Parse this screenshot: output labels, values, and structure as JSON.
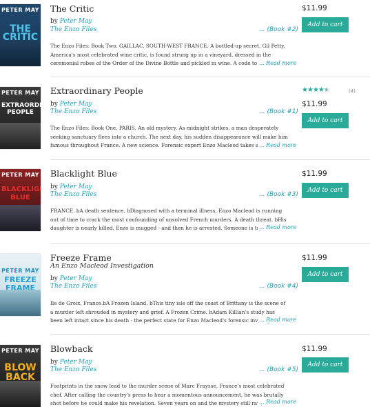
{
  "books": [
    {
      "title": "The Critic",
      "by": "by",
      "author": "Peter May",
      "series": "The Enzo Files",
      "book_num": "... (Book #2)",
      "description": "The Enzo Files: Book Two. GAILLAC, SOUTH-WEST FRANCE. A bottled-up secret. Gil Petty, America's most celebrated wine critic, is found strung up in a vineyard, dressed in the ceremonial robes of the Order of the Divine Bottle and pickled in wine. A code to c...",
      "read_more": "... Read more",
      "price": "$11.99",
      "cart_label": "Add to cart",
      "cover_author": "PETER MAY",
      "cover_title": "THE CRITIC",
      "cover_color": "#1b3f63"
    },
    {
      "title": "Extraordinary People",
      "by": "by",
      "author": "Peter May",
      "series": "The Enzo Files",
      "book_num": "... (Book #1)",
      "description": "The Enzo Files: Book One. PARIS. An old mystery. As midnight strikes, a man desperately seeking sanctuary flees into a church. The next day, his sudden disappearance will make him famous throughout France. A new science. Forensic expert Enzo Macleod takes a ...",
      "read_more": "... Read more",
      "price": "$11.99",
      "cart_label": "Add to cart",
      "rating": 4.5,
      "rating_stars": "★★★★★",
      "rating_count": "(4)",
      "cover_author": "PETER MAY",
      "cover_title": "EXTRAORDINARY PEOPLE",
      "cover_color": "#2d2d2d"
    },
    {
      "title": "Blacklight Blue",
      "by": "by",
      "author": "Peter May",
      "series": "The Enzo Files",
      "book_num": "... (Book #3)",
      "description": "FRANCE. bA death sentence. bDiagnosed with a terminal illness, Enzo Macleod is running out of time to crack the most confounding of unsolved French murders. A death threat. bHis daughter is nearly killed, Enzo is mugged - and then he is arrested. Someone is tryi...",
      "read_more": "... Read more",
      "price": "$11.99",
      "cart_label": "Add to cart",
      "cover_author": "PETER MAY",
      "cover_title": "BLACKLIGHT BLUE",
      "cover_color": "#7a1c1c"
    },
    {
      "title": "Freeze Frame",
      "subtitle": "An Enzo Macleod Investigation",
      "by": "by",
      "author": "Peter May",
      "series": "The Enzo Files",
      "book_num": "... (Book #4)",
      "description": "Ile de Groix, France.bA Frozen Island. bThis tiny isle off the coast of Brittany is the scene of a murder left shrouded in mystery and grief. A Frozen Crime. bAdam Killian's study has been left intact since his death - the perfect state for Enzo Macleod's forensic investigation. ...",
      "read_more": "... Read more",
      "price": "$11.99",
      "cart_label": "Add to cart",
      "cover_author": "PETER MAY",
      "cover_title": "FREEZE FRAME",
      "cover_color": "#1e8fb8"
    },
    {
      "title": "Blowback",
      "by": "by",
      "author": "Peter May",
      "series": "The Enzo Files",
      "book_num": "... (Book #5)",
      "description": "Footprints in the snow lead to the murder scene of Marc Fraysse, France's most celebrated chef. After calling the country's press to hear a momentous announcement, he was brutally shot before he could make his revelation. Seven years on and the mystery still raw, Enzo ...",
      "read_more": "... Read more",
      "price": "$11.99",
      "cart_label": "Add to cart",
      "cover_author": "PETER MAY",
      "cover_title": "BLOW BACK",
      "cover_color": "#2a2a2a"
    }
  ]
}
